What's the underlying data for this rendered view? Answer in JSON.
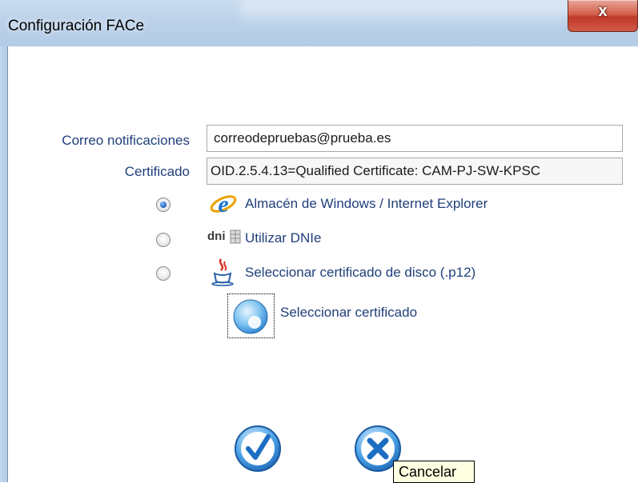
{
  "window": {
    "title": "Configuración FACe",
    "close_glyph": "x"
  },
  "form": {
    "email_label": "Correo notificaciones",
    "email_value": "correodepruebas@prueba.es",
    "certificate_label": "Certificado",
    "certificate_value": "OID.2.5.4.13=Qualified Certificate: CAM-PJ-SW-KPSC"
  },
  "options": [
    {
      "label": "Almacén de Windows / Internet Explorer",
      "icon": "internet-explorer-icon",
      "checked": true
    },
    {
      "label": "Utilizar DNIe",
      "icon": "dni-icon",
      "checked": false
    },
    {
      "label": "Seleccionar certificado de disco (.p12)",
      "icon": "java-icon",
      "checked": false
    }
  ],
  "dni_logo_text": "dni",
  "select_certificate": {
    "label": "Seleccionar certificado",
    "icon": "disc-icon"
  },
  "actions": {
    "accept_icon": "checkmark-icon",
    "cancel_icon": "cancel-x-icon",
    "cancel_tooltip": "Cancelar"
  },
  "colors": {
    "label_blue": "#1f3f7a",
    "accent_blue": "#2b7fd2"
  }
}
